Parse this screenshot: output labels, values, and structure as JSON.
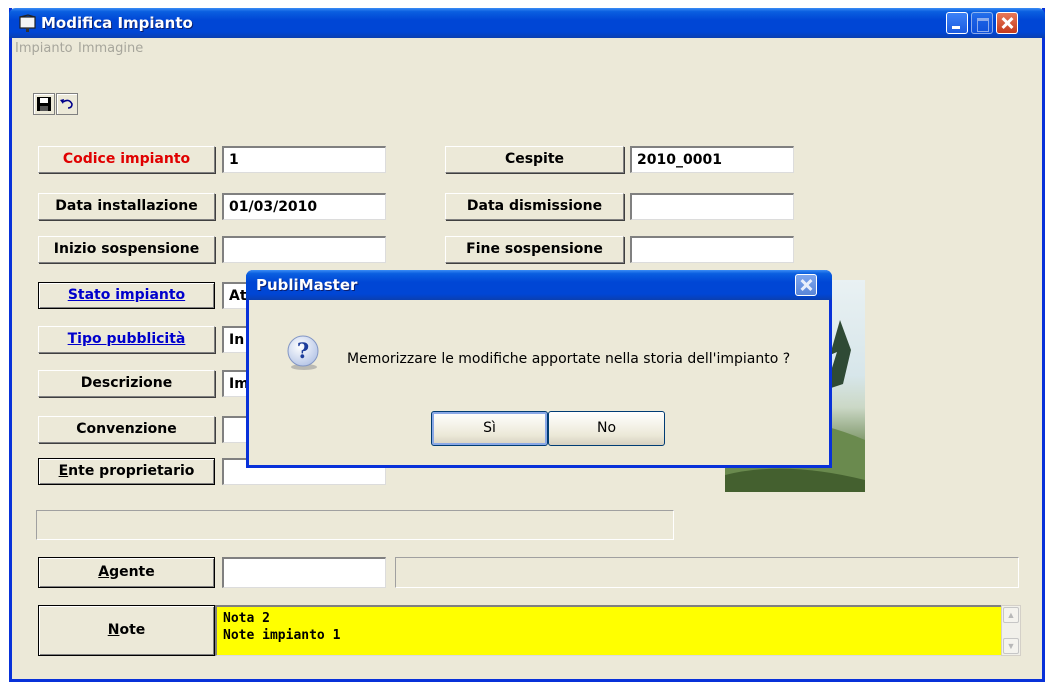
{
  "window": {
    "title": "Modifica Impianto"
  },
  "menu": [
    "Impianto",
    "Immagine"
  ],
  "toolbar": {
    "save_icon": "floppy-disk-icon",
    "undo_icon": "undo-icon"
  },
  "form": {
    "codice_label": "Codice impianto",
    "codice_value": "1",
    "cespite_label": "Cespite",
    "cespite_value": "2010_0001",
    "data_inst_label": "Data installazione",
    "data_inst_value": "01/03/2010",
    "data_dism_label": "Data dismissione",
    "data_dism_value": "",
    "inizio_susp_label": "Inizio sospensione",
    "inizio_susp_value": "",
    "fine_susp_label": "Fine sospensione",
    "fine_susp_value": "",
    "stato_label_pre": "S",
    "stato_label_rest": "tato impianto",
    "stato_value": "At",
    "tipo_label": "Tipo pubblicità",
    "tipo_value": "In",
    "descrizione_label": "Descrizione",
    "descrizione_value": "Im",
    "convenzione_label": "Convenzione",
    "convenzione_value": "",
    "ente_label_pre": "E",
    "ente_label_rest": "nte proprietario",
    "ente_value": "",
    "info_value": "",
    "agente_label_pre": "A",
    "agente_label_rest": "gente",
    "agente_value": "",
    "agente_desc": "",
    "note_label_pre": "N",
    "note_label_rest": "ote",
    "note_line1": "Nota 2",
    "note_line2": "Note impianto 1"
  },
  "dialog": {
    "title": "PubliMaster",
    "message": "Memorizzare le modifiche apportate nella storia dell'impianto ?",
    "yes_label": "Sì",
    "no_label": "No",
    "icon": "question-icon"
  },
  "colors": {
    "title_blue": "#0046d5",
    "note_bg": "#ffff00",
    "required_label": "#e00000",
    "link_label": "#0000cc"
  }
}
